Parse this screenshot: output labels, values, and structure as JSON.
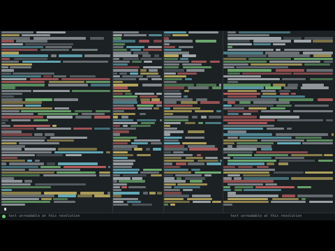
{
  "colors": {
    "background": "#1c2124",
    "text_default": "#b9c0c4",
    "text_dim": "#6f7a80",
    "text_green": "#7fc97f",
    "text_cyan": "#72c6d6",
    "text_yellow": "#d8c36a",
    "text_red": "#d66a6a",
    "status_green": "#6ccf6c",
    "accent_blue": "#4a90d9"
  },
  "panes": [
    {
      "name": "pane-build-log",
      "lines": 60
    },
    {
      "name": "pane-file-list",
      "lines": 60
    },
    {
      "name": "pane-compile-output",
      "lines": 60
    },
    {
      "name": "pane-source-editor",
      "lines": 60
    }
  ],
  "statusbar": {
    "left_label": "text unreadable at this resolution",
    "right_label": "text unreadable at this resolution"
  }
}
